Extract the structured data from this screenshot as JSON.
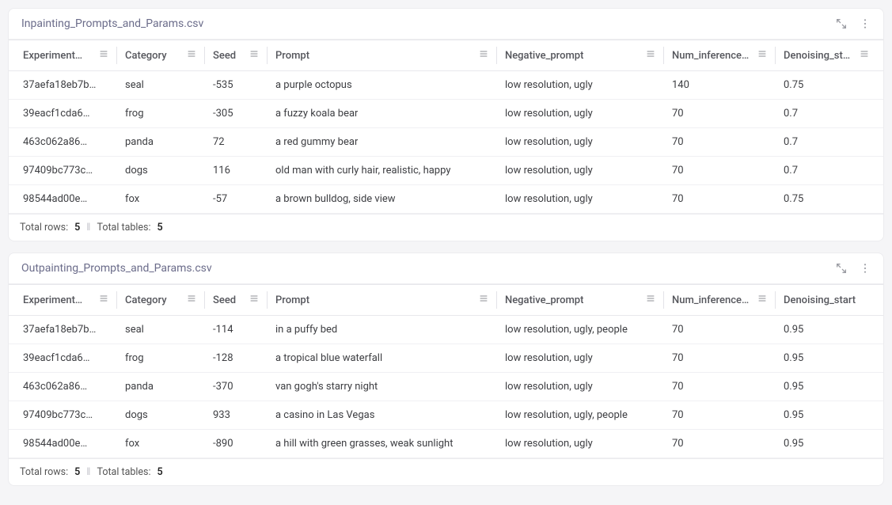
{
  "columns": [
    {
      "key": "exp",
      "label": "Experiment…",
      "class": "c-exp",
      "menu": true
    },
    {
      "key": "cat",
      "label": "Category",
      "class": "c-cat",
      "menu": true
    },
    {
      "key": "seed",
      "label": "Seed",
      "class": "c-seed",
      "menu": true
    },
    {
      "key": "prompt",
      "label": "Prompt",
      "class": "c-prompt",
      "menu": true
    },
    {
      "key": "neg",
      "label": "Negative_prompt",
      "class": "c-neg",
      "menu": true
    },
    {
      "key": "num",
      "label": "Num_inference…",
      "class": "c-num",
      "menu": true
    },
    {
      "key": "den",
      "label": "Denoising_start",
      "class": "c-den",
      "menu": true,
      "menu_optional": true
    }
  ],
  "footer": {
    "rows_label": "Total rows:",
    "rows_value": "5",
    "tables_label": "Total tables:",
    "tables_value": "5"
  },
  "panels": [
    {
      "title": "Inpainting_Prompts_and_Params.csv",
      "den_menu": true,
      "rows": [
        {
          "exp": "37aefa18eb7b…",
          "cat": "seal",
          "seed": "-535",
          "prompt": "a purple octopus",
          "neg": "low resolution, ugly",
          "num": "140",
          "den": "0.75"
        },
        {
          "exp": "39eacf1cda6…",
          "cat": "frog",
          "seed": "-305",
          "prompt": "a fuzzy koala bear",
          "neg": "low resolution, ugly",
          "num": "70",
          "den": "0.7"
        },
        {
          "exp": "463c062a86…",
          "cat": "panda",
          "seed": "72",
          "prompt": "a red gummy bear",
          "neg": "low resolution, ugly",
          "num": "70",
          "den": "0.7"
        },
        {
          "exp": "97409bc773c…",
          "cat": "dogs",
          "seed": "116",
          "prompt": "old man with curly hair, realistic, happy",
          "neg": "low resolution, ugly",
          "num": "70",
          "den": "0.7"
        },
        {
          "exp": "98544ad00e…",
          "cat": "fox",
          "seed": "-57",
          "prompt": "a brown bulldog, side view",
          "neg": "low resolution, ugly",
          "num": "70",
          "den": "0.75"
        }
      ]
    },
    {
      "title": "Outpainting_Prompts_and_Params.csv",
      "den_menu": false,
      "rows": [
        {
          "exp": "37aefa18eb7b…",
          "cat": "seal",
          "seed": "-114",
          "prompt": "in a puffy bed",
          "neg": "low resolution, ugly, people",
          "num": "70",
          "den": "0.95"
        },
        {
          "exp": "39eacf1cda6…",
          "cat": "frog",
          "seed": "-128",
          "prompt": "a tropical blue waterfall",
          "neg": "low resolution, ugly",
          "num": "70",
          "den": "0.95"
        },
        {
          "exp": "463c062a86…",
          "cat": "panda",
          "seed": "-370",
          "prompt": "van gogh's starry night",
          "neg": "low resolution, ugly",
          "num": "70",
          "den": "0.95"
        },
        {
          "exp": "97409bc773c…",
          "cat": "dogs",
          "seed": "933",
          "prompt": "a casino in Las Vegas",
          "neg": "low resolution, ugly, people",
          "num": "70",
          "den": "0.95"
        },
        {
          "exp": "98544ad00e…",
          "cat": "fox",
          "seed": "-890",
          "prompt": "a hill with green grasses, weak sunlight",
          "neg": "low resolution, ugly",
          "num": "70",
          "den": "0.95"
        }
      ]
    }
  ]
}
